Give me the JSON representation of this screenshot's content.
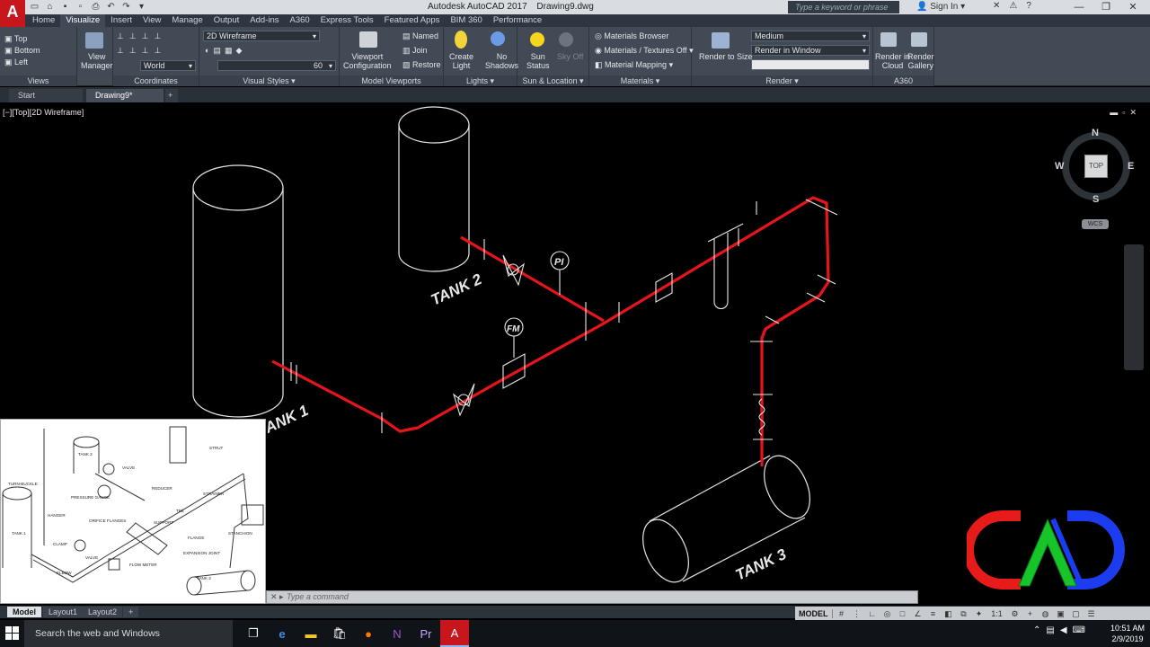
{
  "titlebar": {
    "app_name": "Autodesk AutoCAD 2017",
    "file_name": "Drawing9.dwg",
    "search_placeholder": "Type a keyword or phrase",
    "sign_in": "Sign In"
  },
  "ribbon_tabs": [
    "Home",
    "Visualize",
    "Insert",
    "View",
    "Manage",
    "Output",
    "Add-ins",
    "A360",
    "Express Tools",
    "Featured Apps",
    "BIM 360",
    "Performance"
  ],
  "ribbon_active_tab": "Visualize",
  "ribbon": {
    "views": {
      "items": [
        "Top",
        "Bottom",
        "Left"
      ],
      "title": "Views"
    },
    "view_manager": "View\nManager",
    "coordinates": {
      "ucs_combo": "World",
      "title": "Coordinates"
    },
    "visual_styles": {
      "combo": "2D Wireframe",
      "opacity_value": "60",
      "title": "Visual Styles"
    },
    "model_viewports": {
      "config_label": "Viewport\nConfiguration",
      "named": "Named",
      "join": "Join",
      "restore": "Restore",
      "title": "Model Viewports"
    },
    "lights": {
      "create_light": "Create\nLight",
      "no_shadows": "No\nShadows",
      "title": "Lights"
    },
    "sun": {
      "sun_status": "Sun\nStatus",
      "sky_off": "Sky Off",
      "title": "Sun & Location"
    },
    "materials": {
      "browser": "Materials Browser",
      "textures": "Materials / Textures Off",
      "mapping": "Material Mapping",
      "title": "Materials"
    },
    "render": {
      "render_to_size": "Render to Size",
      "quality": "Medium",
      "render_in": "Render in Window",
      "title": "Render"
    },
    "a360": {
      "render_cloud": "Render in\nCloud",
      "render_gallery": "Render\nGallery",
      "title": "A360"
    }
  },
  "file_tabs": [
    "Start",
    "Drawing9*"
  ],
  "viewport": {
    "label": "[−][Top][2D Wireframe]",
    "viewcube": {
      "n": "N",
      "s": "S",
      "e": "E",
      "w": "W",
      "face": "TOP"
    },
    "wcs": "WCS"
  },
  "drawing": {
    "tank1": "TANK 1",
    "tank2": "TANK 2",
    "tank3": "TANK 3",
    "pi": "PI",
    "fm": "FM",
    "pipe_color": "#e8141b"
  },
  "reference_image": {
    "labels": [
      "TANK 2",
      "VALVE",
      "TURN-BUCKLE",
      "HANGER",
      "PRESSURE GAUGE",
      "REDUCER",
      "ORIFICE FLANGES",
      "TEE",
      "STRAINER",
      "STRUT",
      "SUPPORT",
      "TANK 1",
      "CLAMP",
      "VALVE",
      "FLANGE",
      "STANCHION",
      "ELBOW",
      "FLOW METER",
      "EXPANSION JOINT",
      "TANK 3"
    ]
  },
  "command_line": {
    "placeholder": "Type a command"
  },
  "layout_tabs": [
    "Model",
    "Layout1",
    "Layout2"
  ],
  "statusbar": {
    "model": "MODEL",
    "scale": "1:1"
  },
  "taskbar": {
    "search": "Search the web and Windows",
    "time": "10:51 AM",
    "date": "2/9/2019"
  },
  "logo_colors": {
    "red": "#e81b1b",
    "green": "#17c52a",
    "blue": "#1c3cf0"
  }
}
